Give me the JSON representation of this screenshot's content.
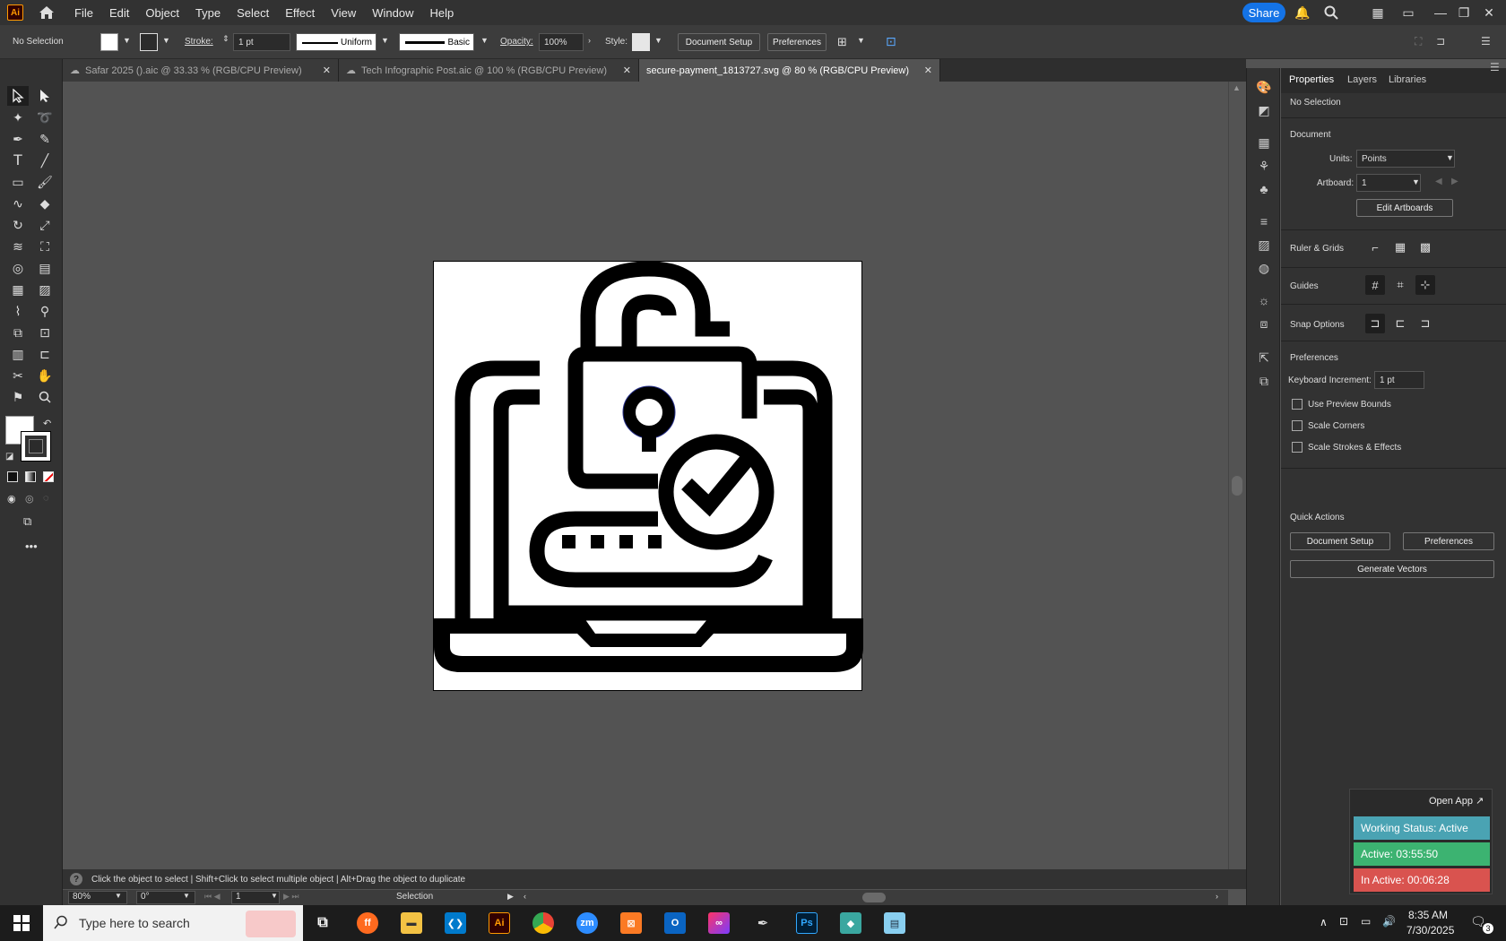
{
  "app": {
    "logo": "Ai",
    "menus": [
      "File",
      "Edit",
      "Object",
      "Type",
      "Select",
      "Effect",
      "View",
      "Window",
      "Help"
    ],
    "share_label": "Share"
  },
  "control_bar": {
    "selection_label": "No Selection",
    "stroke_label": "Stroke:",
    "stroke_value": "1 pt",
    "profile_uniform": "Uniform",
    "brush_basic": "Basic",
    "opacity_label": "Opacity:",
    "opacity_value": "100%",
    "style_label": "Style:",
    "document_setup": "Document Setup",
    "preferences": "Preferences"
  },
  "tabs": [
    {
      "label": "Safar 2025 ().aic @ 33.33 % (RGB/CPU Preview)",
      "active": false
    },
    {
      "label": "Tech Infographic Post.aic @ 100 % (RGB/CPU Preview)",
      "active": false
    },
    {
      "label": "secure-payment_1813727.svg @ 80 % (RGB/CPU Preview)",
      "active": true
    }
  ],
  "status_bar": {
    "hint": "Click the object to select  |  Shift+Click to select multiple object  |  Alt+Drag the object to duplicate",
    "zoom": "80%",
    "rotation": "0°",
    "artboard_nav": "1",
    "mode": "Selection"
  },
  "properties": {
    "tabs": [
      "Properties",
      "Layers",
      "Libraries"
    ],
    "no_selection": "No Selection",
    "document_heading": "Document",
    "units_label": "Units:",
    "units_value": "Points",
    "artboard_label": "Artboard:",
    "artboard_value": "1",
    "edit_artboards": "Edit Artboards",
    "ruler_grids": "Ruler & Grids",
    "guides": "Guides",
    "snap_options": "Snap Options",
    "preferences_heading": "Preferences",
    "keyboard_increment_label": "Keyboard Increment:",
    "keyboard_increment_value": "1 pt",
    "checkboxes": [
      "Use Preview Bounds",
      "Scale Corners",
      "Scale Strokes & Effects"
    ],
    "quick_actions": "Quick Actions",
    "document_setup": "Document Setup",
    "preferences": "Preferences",
    "generate_vectors": "Generate Vectors"
  },
  "widget": {
    "open_app": "Open App ↗",
    "working_status": "Working Status: Active",
    "active": "Active: 03:55:50",
    "inactive": "In Active: 00:06:28",
    "colors": {
      "status": "#4aa3b3",
      "active": "#3cb371",
      "inactive": "#d9534f"
    }
  },
  "taskbar": {
    "search_placeholder": "Type here to search",
    "time": "8:35 AM",
    "date": "7/30/2025",
    "notification_count": "3",
    "apps": [
      "firefox",
      "file-explorer",
      "vscode",
      "illustrator",
      "chrome",
      "zoom",
      "xampp",
      "outlook",
      "creative-cloud",
      "pen-tool",
      "photoshop",
      "app",
      "notepad"
    ]
  }
}
